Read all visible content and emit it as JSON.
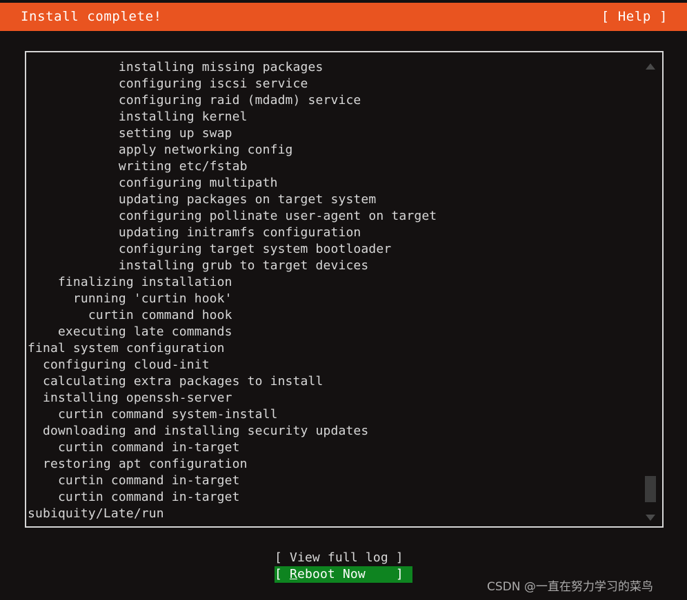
{
  "header": {
    "title": "Install complete!",
    "help_label": "[ Help ]",
    "background_color": "#e95420",
    "text_color": "#ffffff"
  },
  "log": {
    "lines": [
      "            installing missing packages",
      "            configuring iscsi service",
      "            configuring raid (mdadm) service",
      "            installing kernel",
      "            setting up swap",
      "            apply networking config",
      "            writing etc/fstab",
      "            configuring multipath",
      "            updating packages on target system",
      "            configuring pollinate user-agent on target",
      "            updating initramfs configuration",
      "            configuring target system bootloader",
      "            installing grub to target devices",
      "    finalizing installation",
      "      running 'curtin hook'",
      "        curtin command hook",
      "    executing late commands",
      "final system configuration",
      "  configuring cloud-init",
      "  calculating extra packages to install",
      "  installing openssh-server",
      "    curtin command system-install",
      "  downloading and installing security updates",
      "    curtin command in-target",
      "  restoring apt configuration",
      "    curtin command in-target",
      "    curtin command in-target",
      "subiquity/Late/run"
    ],
    "text_color": "#d8d8d8",
    "border_color": "#d6d6d6"
  },
  "scrollbar": {
    "up_arrow_icon": "triangle-up-icon",
    "down_arrow_icon": "triangle-down-icon",
    "thumb_color": "#3b3b3b"
  },
  "buttons": {
    "view_full_log": "[ View full log ]",
    "reboot_now_prefix": "[ ",
    "reboot_now_hotkey": "R",
    "reboot_now_rest": "eboot Now",
    "reboot_now_suffix": "    ]",
    "reboot_now_full": "[ Reboot Now    ]",
    "selected_background_color": "#0e8420"
  },
  "watermark": {
    "text": "CSDN @一直在努力学习的菜鸟"
  }
}
